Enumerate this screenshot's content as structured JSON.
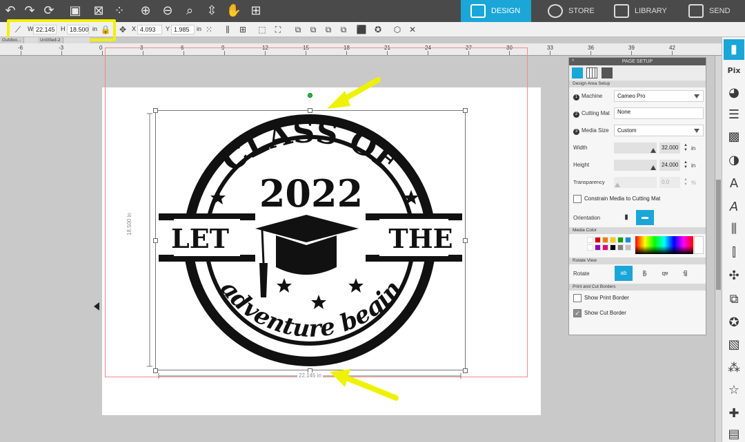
{
  "nav": {
    "tabs": [
      {
        "label": "DESIGN",
        "active": true
      },
      {
        "label": "STORE",
        "active": false
      },
      {
        "label": "LIBRARY",
        "active": false
      },
      {
        "label": "SEND",
        "active": false
      }
    ]
  },
  "props": {
    "w_label": "W",
    "w_value": "22.145",
    "h_label": "H",
    "h_value": "18.500",
    "unit": "in",
    "x_label": "X",
    "x_value": "4.093",
    "y_label": "Y",
    "y_value": "1.985",
    "unit2": "in"
  },
  "doc_tabs": [
    "Outdoo...",
    "Untitled-2"
  ],
  "ruler": {
    "ticks": [
      "-6",
      "-3",
      "0",
      "3",
      "6",
      "9",
      "12",
      "15",
      "18",
      "21",
      "24",
      "27",
      "30",
      "33",
      "36",
      "39",
      "42"
    ]
  },
  "design": {
    "line1": "CLASS OF",
    "year": "2022",
    "left_word": "LET",
    "right_word": "THE",
    "script": "adventure begin",
    "width_dim": "22.145 in",
    "height_dim": "18.500 in"
  },
  "panel": {
    "title": "PAGE SETUP",
    "section_area": "Design Area Setup",
    "machine_label": "Machine",
    "machine_value": "Cameo Pro",
    "mat_label": "Cutting Mat",
    "mat_value": "None",
    "media_size_label": "Media Size",
    "media_size_value": "Custom",
    "width_label": "Width",
    "width_value": "32.000",
    "height_label": "Height",
    "height_value": "24.000",
    "transparency_label": "Transparency",
    "transparency_value": "0.0",
    "unit_in": "in",
    "unit_pct": "%",
    "constrain_label": "Constrain Media to Cutting Mat",
    "orientation_label": "Orientation",
    "section_color": "Media Color",
    "section_rotate": "Rotate View",
    "rotate_label": "Rotate",
    "rotate_options": [
      "ab",
      "ab",
      "ab",
      "ab"
    ],
    "section_borders": "Print and Cut Borders",
    "print_border_label": "Show Print Border",
    "cut_border_label": "Show Cut Border",
    "step_numbers": [
      "1",
      "2",
      "3"
    ]
  },
  "colors": {
    "accent": "#1ba6d8",
    "highlight": "#f4f000",
    "swatches": [
      "#ffffff",
      "#e00000",
      "#f07800",
      "#f0d000",
      "#00a000",
      "#0090e0",
      "#ffffff",
      "#9000c0",
      "#e0007a",
      "#000000",
      "#808080",
      "#c0c0c0"
    ]
  }
}
